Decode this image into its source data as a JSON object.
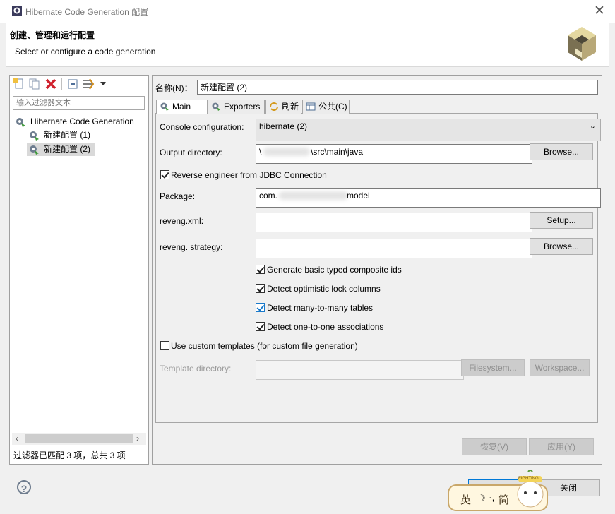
{
  "window": {
    "title": "Hibernate Code Generation 配置",
    "close_glyph": "✕"
  },
  "header": {
    "title": "创建、管理和运行配置",
    "description": "Select or configure a code generation"
  },
  "filter": {
    "placeholder": "输入过滤器文本"
  },
  "tree": {
    "root": "Hibernate Code Generation",
    "items": [
      {
        "label": "新建配置 (1)",
        "selected": false
      },
      {
        "label": "新建配置 (2)",
        "selected": true
      }
    ]
  },
  "status": {
    "text": "过滤器已匹配 3 项，总共 3 项"
  },
  "config": {
    "name_label": "名称(N)：",
    "name_value": "新建配置 (2)"
  },
  "tabs": [
    {
      "label": "Main",
      "active": true
    },
    {
      "label": "Exporters",
      "active": false
    },
    {
      "label": "刷新",
      "active": false
    },
    {
      "label": "公共(C)",
      "active": false
    }
  ],
  "main": {
    "console_label": "Console configuration:",
    "console_value": "hibernate (2)",
    "output_label": "Output directory:",
    "output_value_prefix": "\\",
    "output_value_suffix": "\\src\\main\\java",
    "output_browse": "Browse...",
    "reverse_label": "Reverse engineer from JDBC Connection",
    "package_label": "Package:",
    "package_value_prefix": "com.",
    "package_value_suffix": "model",
    "reveng_label": "reveng.xml:",
    "setup_button": "Setup...",
    "strategy_label": "reveng. strategy:",
    "strategy_browse": "Browse...",
    "checks": [
      {
        "label": "Generate basic typed composite ids",
        "checked": true
      },
      {
        "label": "Detect optimistic lock columns",
        "checked": true
      },
      {
        "label": "Detect many-to-many tables",
        "checked": true
      },
      {
        "label": "Detect one-to-one associations",
        "checked": true
      }
    ],
    "custom_templates_label": "Use custom templates (for custom file generation)",
    "template_dir_label": "Template directory:",
    "filesystem_button": "Filesystem...",
    "workspace_button": "Workspace..."
  },
  "buttons": {
    "revert": "恢复(V)",
    "apply": "应用(Y)",
    "close": "关闭"
  },
  "ime": {
    "mode": "英",
    "simplified": "简",
    "badge": "FIGHTING"
  }
}
